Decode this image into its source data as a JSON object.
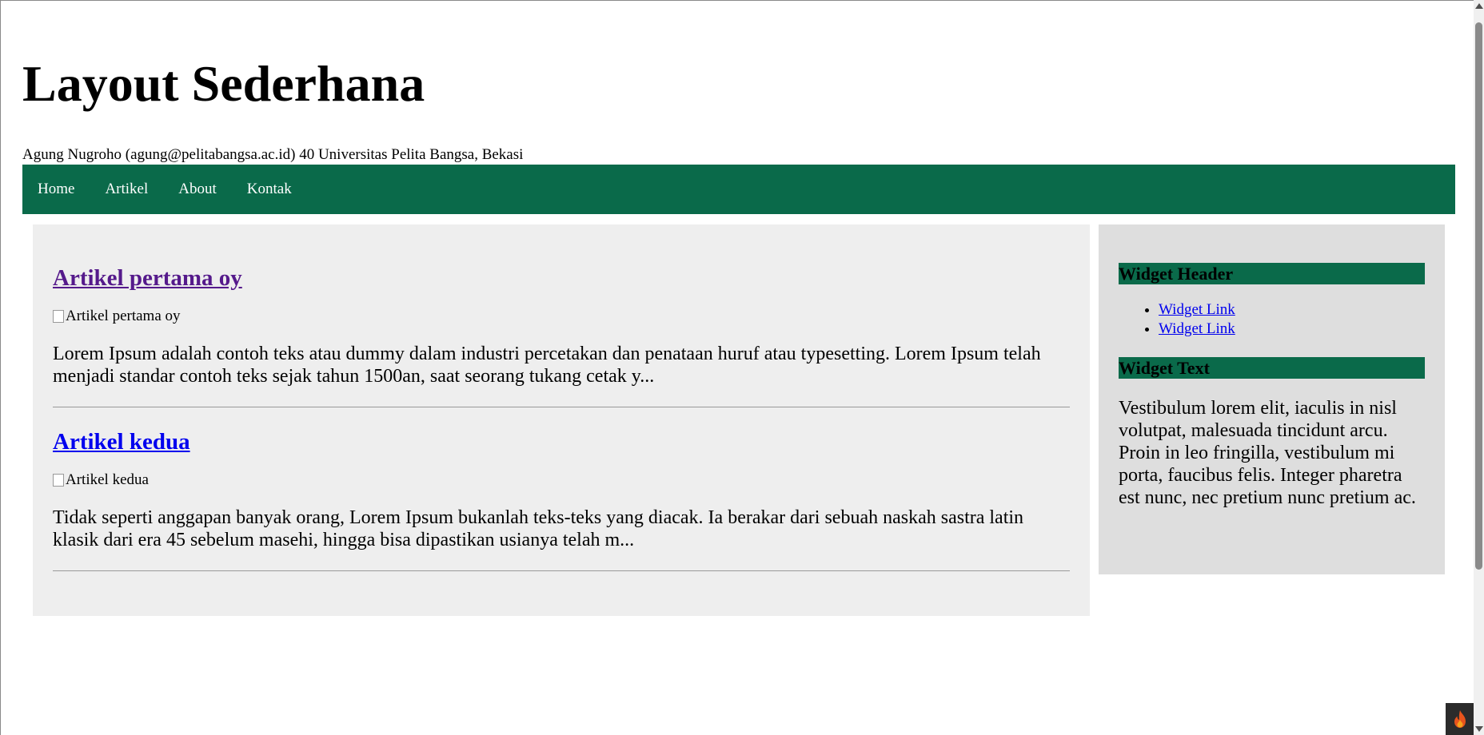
{
  "header": {
    "title": "Layout Sederhana",
    "subtitle": "Agung Nugroho (agung@pelitabangsa.ac.id) 40 Universitas Pelita Bangsa, Bekasi"
  },
  "nav": {
    "items": [
      {
        "label": "Home"
      },
      {
        "label": "Artikel"
      },
      {
        "label": "About"
      },
      {
        "label": "Kontak"
      }
    ]
  },
  "articles": [
    {
      "title": "Artikel pertama oy",
      "image_alt": "Artikel pertama oy",
      "excerpt": "Lorem Ipsum adalah contoh teks atau dummy dalam industri percetakan dan penataan huruf atau typesetting. Lorem Ipsum telah menjadi standar contoh teks sejak tahun 1500an, saat seorang tukang cetak y..."
    },
    {
      "title": "Artikel kedua",
      "image_alt": "Artikel kedua",
      "excerpt": "Tidak seperti anggapan banyak orang, Lorem Ipsum bukanlah teks-teks yang diacak. Ia berakar dari sebuah naskah sastra latin klasik dari era 45 sebelum masehi, hingga bisa dipastikan usianya telah m..."
    }
  ],
  "sidebar": {
    "widget_header": "Widget Header",
    "links": [
      {
        "label": "Widget Link"
      },
      {
        "label": "Widget Link"
      }
    ],
    "widget_text_header": "Widget Text",
    "widget_text": "Vestibulum lorem elit, iaculis in nisl volutpat, malesuada tincidunt arcu. Proin in leo fringilla, vestibulum mi porta, faucibus felis. Integer pharetra est nunc, nec pretium nunc pretium ac."
  },
  "colors": {
    "nav_background": "#0a6a4a",
    "content_background": "#eeeeee",
    "sidebar_background": "#dedede",
    "link": "#0000ee",
    "visited_link": "#551a8b"
  },
  "icons": {
    "corner_badge": "flame-icon"
  }
}
